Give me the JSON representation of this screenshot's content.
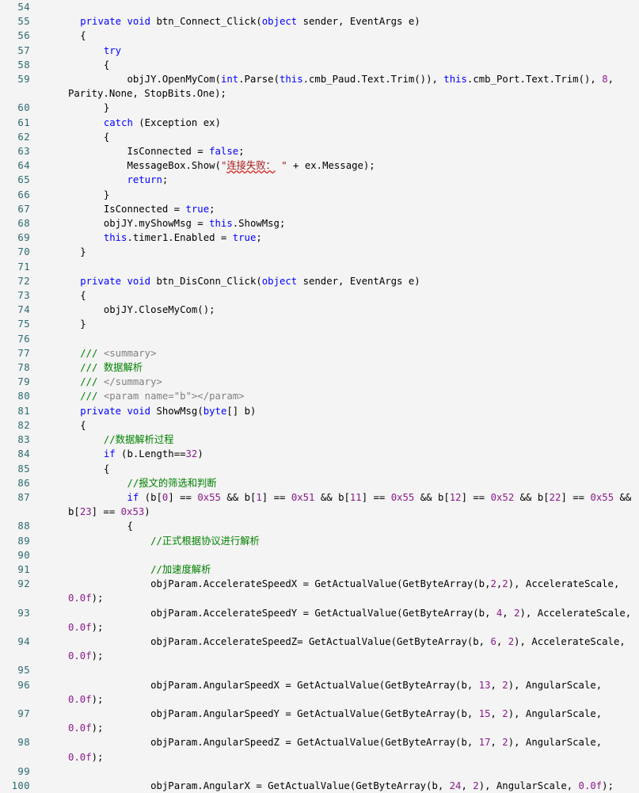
{
  "editor": {
    "background_color": "#f4f4f4",
    "gutter_color": "#2b6a70",
    "colors": {
      "keyword": "#0000ff",
      "number": "#8b1a8b",
      "string": "#a31515",
      "comment": "#008000",
      "xmldoc": "#808080",
      "plain": "#000000",
      "squiggle": "#e01b1b"
    },
    "first_line": 54,
    "last_line": 100,
    "language": "C#"
  },
  "lines": [
    {
      "num": "54",
      "tokens": []
    },
    {
      "num": "55",
      "tokens": [
        {
          "t": "        ",
          "c": "p"
        },
        {
          "t": "private",
          "c": "k"
        },
        {
          "t": " ",
          "c": "p"
        },
        {
          "t": "void",
          "c": "k"
        },
        {
          "t": " btn_Connect_Click(",
          "c": "p"
        },
        {
          "t": "object",
          "c": "k"
        },
        {
          "t": " sender, EventArgs e)",
          "c": "p"
        }
      ]
    },
    {
      "num": "56",
      "tokens": [
        {
          "t": "        {",
          "c": "p"
        }
      ]
    },
    {
      "num": "57",
      "tokens": [
        {
          "t": "            ",
          "c": "p"
        },
        {
          "t": "try",
          "c": "k"
        }
      ]
    },
    {
      "num": "58",
      "tokens": [
        {
          "t": "            {",
          "c": "p"
        }
      ]
    },
    {
      "num": "59",
      "tokens": [
        {
          "t": "                objJY.OpenMyCom(",
          "c": "p"
        },
        {
          "t": "int",
          "c": "k"
        },
        {
          "t": ".Parse(",
          "c": "p"
        },
        {
          "t": "this",
          "c": "k"
        },
        {
          "t": ".cmb_Paud.Text.Trim()), ",
          "c": "p"
        },
        {
          "t": "this",
          "c": "k"
        },
        {
          "t": ".cmb_Port.Text.Trim(), ",
          "c": "p"
        },
        {
          "t": "8",
          "c": "n"
        },
        {
          "t": ", Parity.None, StopBits.One);",
          "c": "p"
        }
      ]
    },
    {
      "num": "60",
      "tokens": [
        {
          "t": "            }",
          "c": "p"
        }
      ]
    },
    {
      "num": "61",
      "tokens": [
        {
          "t": "            ",
          "c": "p"
        },
        {
          "t": "catch",
          "c": "k"
        },
        {
          "t": " (Exception ex)",
          "c": "p"
        }
      ]
    },
    {
      "num": "62",
      "tokens": [
        {
          "t": "            {",
          "c": "p"
        }
      ]
    },
    {
      "num": "63",
      "tokens": [
        {
          "t": "                IsConnected = ",
          "c": "p"
        },
        {
          "t": "false",
          "c": "k"
        },
        {
          "t": ";",
          "c": "p"
        }
      ]
    },
    {
      "num": "64",
      "tokens": [
        {
          "t": "                MessageBox.Show(",
          "c": "p"
        },
        {
          "t": "\"",
          "c": "s"
        },
        {
          "t": "连接失败：",
          "c": "s",
          "sq": true
        },
        {
          "t": " \"",
          "c": "s"
        },
        {
          "t": " + ex.Message);",
          "c": "p"
        }
      ]
    },
    {
      "num": "65",
      "tokens": [
        {
          "t": "                ",
          "c": "p"
        },
        {
          "t": "return",
          "c": "k"
        },
        {
          "t": ";",
          "c": "p"
        }
      ]
    },
    {
      "num": "66",
      "tokens": [
        {
          "t": "            }",
          "c": "p"
        }
      ]
    },
    {
      "num": "67",
      "tokens": [
        {
          "t": "            IsConnected = ",
          "c": "p"
        },
        {
          "t": "true",
          "c": "k"
        },
        {
          "t": ";",
          "c": "p"
        }
      ]
    },
    {
      "num": "68",
      "tokens": [
        {
          "t": "            objJY.myShowMsg = ",
          "c": "p"
        },
        {
          "t": "this",
          "c": "k"
        },
        {
          "t": ".ShowMsg;",
          "c": "p"
        }
      ]
    },
    {
      "num": "69",
      "tokens": [
        {
          "t": "            ",
          "c": "p"
        },
        {
          "t": "this",
          "c": "k"
        },
        {
          "t": ".timer1.Enabled = ",
          "c": "p"
        },
        {
          "t": "true",
          "c": "k"
        },
        {
          "t": ";",
          "c": "p"
        }
      ]
    },
    {
      "num": "70",
      "tokens": [
        {
          "t": "        }",
          "c": "p"
        }
      ]
    },
    {
      "num": "71",
      "tokens": []
    },
    {
      "num": "72",
      "tokens": [
        {
          "t": "        ",
          "c": "p"
        },
        {
          "t": "private",
          "c": "k"
        },
        {
          "t": " ",
          "c": "p"
        },
        {
          "t": "void",
          "c": "k"
        },
        {
          "t": " btn_DisConn_Click(",
          "c": "p"
        },
        {
          "t": "object",
          "c": "k"
        },
        {
          "t": " sender, EventArgs e)",
          "c": "p"
        }
      ]
    },
    {
      "num": "73",
      "tokens": [
        {
          "t": "        {",
          "c": "p"
        }
      ]
    },
    {
      "num": "74",
      "tokens": [
        {
          "t": "            objJY.CloseMyCom();",
          "c": "p"
        }
      ]
    },
    {
      "num": "75",
      "tokens": [
        {
          "t": "        }",
          "c": "p"
        }
      ]
    },
    {
      "num": "76",
      "tokens": []
    },
    {
      "num": "77",
      "tokens": [
        {
          "t": "        ",
          "c": "p"
        },
        {
          "t": "///",
          "c": "c"
        },
        {
          "t": " <summary>",
          "c": "x"
        }
      ]
    },
    {
      "num": "78",
      "tokens": [
        {
          "t": "        ",
          "c": "p"
        },
        {
          "t": "/// 数据解析",
          "c": "c"
        }
      ]
    },
    {
      "num": "79",
      "tokens": [
        {
          "t": "        ",
          "c": "p"
        },
        {
          "t": "///",
          "c": "c"
        },
        {
          "t": " </summary>",
          "c": "x"
        }
      ]
    },
    {
      "num": "80",
      "tokens": [
        {
          "t": "        ",
          "c": "p"
        },
        {
          "t": "///",
          "c": "c"
        },
        {
          "t": " <param name=\"b\"></param>",
          "c": "x"
        }
      ]
    },
    {
      "num": "81",
      "tokens": [
        {
          "t": "        ",
          "c": "p"
        },
        {
          "t": "private",
          "c": "k"
        },
        {
          "t": " ",
          "c": "p"
        },
        {
          "t": "void",
          "c": "k"
        },
        {
          "t": " ShowMsg(",
          "c": "p"
        },
        {
          "t": "byte",
          "c": "k"
        },
        {
          "t": "[] b)",
          "c": "p"
        }
      ]
    },
    {
      "num": "82",
      "tokens": [
        {
          "t": "        {",
          "c": "p"
        }
      ]
    },
    {
      "num": "83",
      "tokens": [
        {
          "t": "            ",
          "c": "p"
        },
        {
          "t": "//数据解析过程",
          "c": "c"
        }
      ]
    },
    {
      "num": "84",
      "tokens": [
        {
          "t": "            ",
          "c": "p"
        },
        {
          "t": "if",
          "c": "k"
        },
        {
          "t": " (b.Length==",
          "c": "p"
        },
        {
          "t": "32",
          "c": "n"
        },
        {
          "t": ")",
          "c": "p"
        }
      ]
    },
    {
      "num": "85",
      "tokens": [
        {
          "t": "            {",
          "c": "p"
        }
      ]
    },
    {
      "num": "86",
      "tokens": [
        {
          "t": "                ",
          "c": "p"
        },
        {
          "t": "//报文的筛选和判断",
          "c": "c"
        }
      ]
    },
    {
      "num": "87",
      "tokens": [
        {
          "t": "                ",
          "c": "p"
        },
        {
          "t": "if",
          "c": "k"
        },
        {
          "t": " (b[",
          "c": "p"
        },
        {
          "t": "0",
          "c": "n"
        },
        {
          "t": "] == ",
          "c": "p"
        },
        {
          "t": "0x55",
          "c": "n"
        },
        {
          "t": " && b[",
          "c": "p"
        },
        {
          "t": "1",
          "c": "n"
        },
        {
          "t": "] == ",
          "c": "p"
        },
        {
          "t": "0x51",
          "c": "n"
        },
        {
          "t": " && b[",
          "c": "p"
        },
        {
          "t": "11",
          "c": "n"
        },
        {
          "t": "] == ",
          "c": "p"
        },
        {
          "t": "0x55",
          "c": "n"
        },
        {
          "t": " && b[",
          "c": "p"
        },
        {
          "t": "12",
          "c": "n"
        },
        {
          "t": "] == ",
          "c": "p"
        },
        {
          "t": "0x52",
          "c": "n"
        },
        {
          "t": " && b[",
          "c": "p"
        },
        {
          "t": "22",
          "c": "n"
        },
        {
          "t": "] == ",
          "c": "p"
        },
        {
          "t": "0x55",
          "c": "n"
        },
        {
          "t": " && b[",
          "c": "p"
        },
        {
          "t": "23",
          "c": "n"
        },
        {
          "t": "] == ",
          "c": "p"
        },
        {
          "t": "0x53",
          "c": "n"
        },
        {
          "t": ")",
          "c": "p"
        }
      ]
    },
    {
      "num": "88",
      "tokens": [
        {
          "t": "                {",
          "c": "p"
        }
      ]
    },
    {
      "num": "89",
      "tokens": [
        {
          "t": "                    ",
          "c": "p"
        },
        {
          "t": "//正式根据协议进行解析",
          "c": "c"
        }
      ]
    },
    {
      "num": "90",
      "tokens": []
    },
    {
      "num": "91",
      "tokens": [
        {
          "t": "                    ",
          "c": "p"
        },
        {
          "t": "//加速度解析",
          "c": "c"
        }
      ]
    },
    {
      "num": "92",
      "tokens": [
        {
          "t": "                    objParam.AccelerateSpeedX = GetActualValue(GetByteArray(b,",
          "c": "p"
        },
        {
          "t": "2",
          "c": "n"
        },
        {
          "t": ",",
          "c": "p"
        },
        {
          "t": "2",
          "c": "n"
        },
        {
          "t": "), AccelerateScale, ",
          "c": "p"
        },
        {
          "t": "0.0f",
          "c": "n"
        },
        {
          "t": ");",
          "c": "p"
        }
      ]
    },
    {
      "num": "93",
      "tokens": [
        {
          "t": "                    objParam.AccelerateSpeedY = GetActualValue(GetByteArray(b, ",
          "c": "p"
        },
        {
          "t": "4",
          "c": "n"
        },
        {
          "t": ", ",
          "c": "p"
        },
        {
          "t": "2",
          "c": "n"
        },
        {
          "t": "), AccelerateScale, ",
          "c": "p"
        },
        {
          "t": "0.0f",
          "c": "n"
        },
        {
          "t": ");",
          "c": "p"
        }
      ]
    },
    {
      "num": "94",
      "tokens": [
        {
          "t": "                    objParam.AccelerateSpeedZ= GetActualValue(GetByteArray(b, ",
          "c": "p"
        },
        {
          "t": "6",
          "c": "n"
        },
        {
          "t": ", ",
          "c": "p"
        },
        {
          "t": "2",
          "c": "n"
        },
        {
          "t": "), AccelerateScale, ",
          "c": "p"
        },
        {
          "t": "0.0f",
          "c": "n"
        },
        {
          "t": ");",
          "c": "p"
        }
      ]
    },
    {
      "num": "95",
      "tokens": []
    },
    {
      "num": "96",
      "tokens": [
        {
          "t": "                    objParam.AngularSpeedX = GetActualValue(GetByteArray(b, ",
          "c": "p"
        },
        {
          "t": "13",
          "c": "n"
        },
        {
          "t": ", ",
          "c": "p"
        },
        {
          "t": "2",
          "c": "n"
        },
        {
          "t": "), AngularScale, ",
          "c": "p"
        },
        {
          "t": "0.0f",
          "c": "n"
        },
        {
          "t": ");",
          "c": "p"
        }
      ]
    },
    {
      "num": "97",
      "tokens": [
        {
          "t": "                    objParam.AngularSpeedY = GetActualValue(GetByteArray(b, ",
          "c": "p"
        },
        {
          "t": "15",
          "c": "n"
        },
        {
          "t": ", ",
          "c": "p"
        },
        {
          "t": "2",
          "c": "n"
        },
        {
          "t": "), AngularScale, ",
          "c": "p"
        },
        {
          "t": "0.0f",
          "c": "n"
        },
        {
          "t": ");",
          "c": "p"
        }
      ]
    },
    {
      "num": "98",
      "tokens": [
        {
          "t": "                    objParam.AngularSpeedZ = GetActualValue(GetByteArray(b, ",
          "c": "p"
        },
        {
          "t": "17",
          "c": "n"
        },
        {
          "t": ", ",
          "c": "p"
        },
        {
          "t": "2",
          "c": "n"
        },
        {
          "t": "), AngularScale, ",
          "c": "p"
        },
        {
          "t": "0.0f",
          "c": "n"
        },
        {
          "t": ");",
          "c": "p"
        }
      ]
    },
    {
      "num": "99",
      "tokens": []
    },
    {
      "num": "100",
      "tokens": [
        {
          "t": "                    objParam.AngularX = GetActualValue(GetByteArray(b, ",
          "c": "p"
        },
        {
          "t": "24",
          "c": "n"
        },
        {
          "t": ", ",
          "c": "p"
        },
        {
          "t": "2",
          "c": "n"
        },
        {
          "t": "), AngularScale, ",
          "c": "p"
        },
        {
          "t": "0.0f",
          "c": "n"
        },
        {
          "t": ");",
          "c": "p"
        }
      ]
    }
  ]
}
